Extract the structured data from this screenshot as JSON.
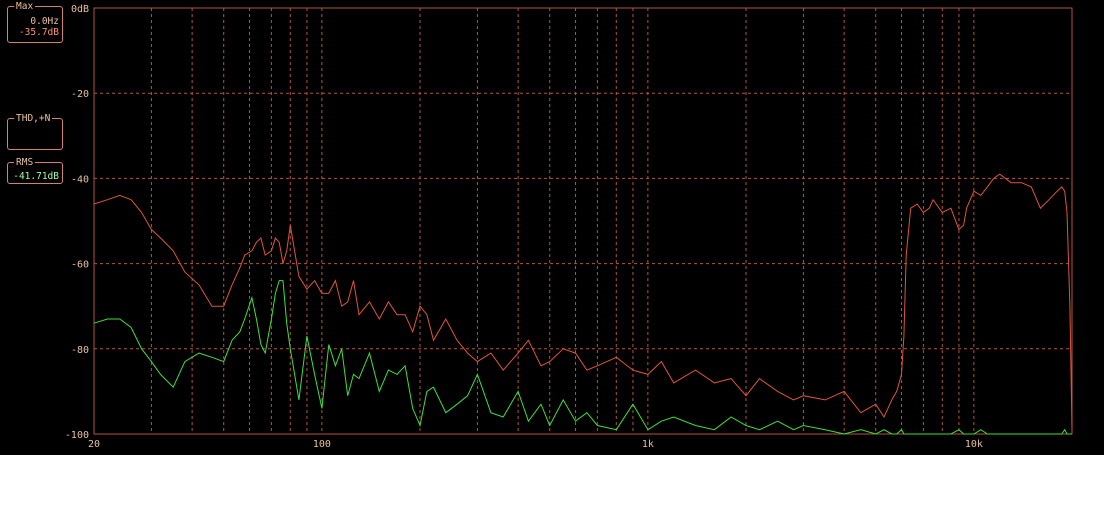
{
  "panels": {
    "max": {
      "label": "Max",
      "freq": "0.0Hz",
      "level": "-35.7dB"
    },
    "thd": {
      "label": "THD,+N"
    },
    "rms": {
      "label": "RMS",
      "level": "-41.71dB"
    }
  },
  "colors": {
    "background": "#000000",
    "grid": "#b5543c",
    "series_red": "#e0533d",
    "series_green": "#3ce03c",
    "text": "#e8c0a0"
  },
  "chart_data": {
    "type": "line",
    "xscale": "log",
    "xlim": [
      20,
      20000
    ],
    "ylim": [
      -100,
      0
    ],
    "grid": true,
    "x_tick_labels": [
      {
        "value": 20,
        "label": "20"
      },
      {
        "value": 100,
        "label": "100"
      },
      {
        "value": 1000,
        "label": "1k"
      },
      {
        "value": 10000,
        "label": "10k"
      }
    ],
    "y_tick_labels": [
      {
        "value": 0,
        "label": "0dB"
      },
      {
        "value": -20,
        "label": "-20"
      },
      {
        "value": -40,
        "label": "-40"
      },
      {
        "value": -60,
        "label": "-60"
      },
      {
        "value": -80,
        "label": "-80"
      },
      {
        "value": -100,
        "label": "-100"
      }
    ],
    "series": [
      {
        "color": "#e0533d",
        "x": [
          20,
          22,
          24,
          26,
          28,
          30,
          32,
          35,
          38,
          42,
          46,
          50,
          53,
          56,
          58,
          61,
          63,
          65,
          67,
          70,
          72,
          74,
          76,
          78,
          80,
          85,
          90,
          95,
          100,
          105,
          110,
          115,
          120,
          125,
          130,
          140,
          150,
          160,
          170,
          180,
          190,
          200,
          210,
          220,
          240,
          260,
          280,
          300,
          330,
          360,
          400,
          430,
          470,
          500,
          550,
          600,
          650,
          700,
          800,
          900,
          1000,
          1100,
          1200,
          1400,
          1600,
          1800,
          2000,
          2200,
          2500,
          2800,
          3000,
          3500,
          4000,
          4500,
          5000,
          5300,
          5600,
          5800,
          6000,
          6100,
          6200,
          6400,
          6700,
          7000,
          7300,
          7500,
          8000,
          8500,
          9000,
          9300,
          9500,
          10000,
          10500,
          11000,
          11500,
          12000,
          13000,
          14000,
          15000,
          16000,
          17000,
          18000,
          18600,
          19000,
          19300,
          19700,
          20000
        ],
        "y": [
          -46,
          -45,
          -44,
          -45,
          -48,
          -52,
          -54,
          -57,
          -62,
          -65,
          -70,
          -70,
          -65,
          -61,
          -58,
          -57,
          -55,
          -54,
          -58,
          -57,
          -54,
          -55,
          -60,
          -57,
          -51,
          -63,
          -66,
          -64,
          -67,
          -67,
          -64,
          -70,
          -69,
          -64,
          -72,
          -69,
          -73,
          -69,
          -72,
          -72,
          -76,
          -70,
          -72,
          -78,
          -73,
          -78,
          -81,
          -83,
          -81,
          -85,
          -81,
          -78,
          -84,
          -83,
          -80,
          -81,
          -85,
          -84,
          -82,
          -85,
          -86,
          -83,
          -88,
          -85,
          -88,
          -87,
          -91,
          -87,
          -90,
          -92,
          -91,
          -92,
          -90,
          -95,
          -93,
          -96,
          -92,
          -90,
          -86,
          -77,
          -58,
          -47,
          -46,
          -48,
          -47,
          -45,
          -48,
          -47,
          -52,
          -51,
          -47,
          -43,
          -44,
          -42,
          -40,
          -39,
          -41,
          -41,
          -42,
          -47,
          -45,
          -43,
          -42,
          -43,
          -48,
          -70,
          -99
        ]
      },
      {
        "color": "#3ce03c",
        "x": [
          20,
          22,
          24,
          26,
          28,
          30,
          32,
          35,
          38,
          42,
          46,
          50,
          53,
          56,
          58,
          61,
          63,
          65,
          67,
          70,
          72,
          74,
          76,
          78,
          80,
          85,
          90,
          95,
          100,
          105,
          110,
          115,
          120,
          125,
          130,
          140,
          150,
          160,
          170,
          180,
          190,
          200,
          210,
          220,
          240,
          260,
          280,
          300,
          330,
          360,
          400,
          430,
          470,
          500,
          550,
          600,
          650,
          700,
          800,
          900,
          1000,
          1100,
          1200,
          1400,
          1600,
          1800,
          2000,
          2200,
          2500,
          2800,
          3000,
          3500,
          4000,
          4500,
          5000,
          5300,
          5600,
          5800,
          6000,
          6100,
          6200,
          6400,
          6700,
          7000,
          7300,
          7500,
          8000,
          8500,
          9000,
          9300,
          9500,
          10000,
          10500,
          11000,
          11500,
          12000,
          13000,
          14000,
          15000,
          16000,
          17000,
          18000,
          18600,
          19000,
          19300,
          19700,
          20000
        ],
        "y": [
          -74,
          -73,
          -73,
          -75,
          -80,
          -83,
          -86,
          -89,
          -83,
          -81,
          -82,
          -83,
          -78,
          -76,
          -73,
          -68,
          -73,
          -79,
          -81,
          -73,
          -67,
          -64,
          -64,
          -74,
          -80,
          -92,
          -77,
          -86,
          -94,
          -79,
          -84,
          -80,
          -91,
          -86,
          -87,
          -81,
          -90,
          -85,
          -86,
          -84,
          -94,
          -98,
          -90,
          -89,
          -95,
          -93,
          -91,
          -86,
          -95,
          -96,
          -90,
          -97,
          -93,
          -98,
          -92,
          -97,
          -95,
          -98,
          -99,
          -93,
          -99,
          -97,
          -96,
          -98,
          -99,
          -96,
          -98,
          -99,
          -97,
          -99,
          -98,
          -99,
          -100,
          -99,
          -100,
          -99,
          -100,
          -100,
          -99,
          -100,
          -100,
          -100,
          -100,
          -100,
          -100,
          -100,
          -100,
          -100,
          -99,
          -100,
          -100,
          -100,
          -99,
          -100,
          -100,
          -100,
          -100,
          -100,
          -100,
          -100,
          -100,
          -100,
          -100,
          -99,
          -100,
          -100,
          -100
        ]
      }
    ]
  }
}
